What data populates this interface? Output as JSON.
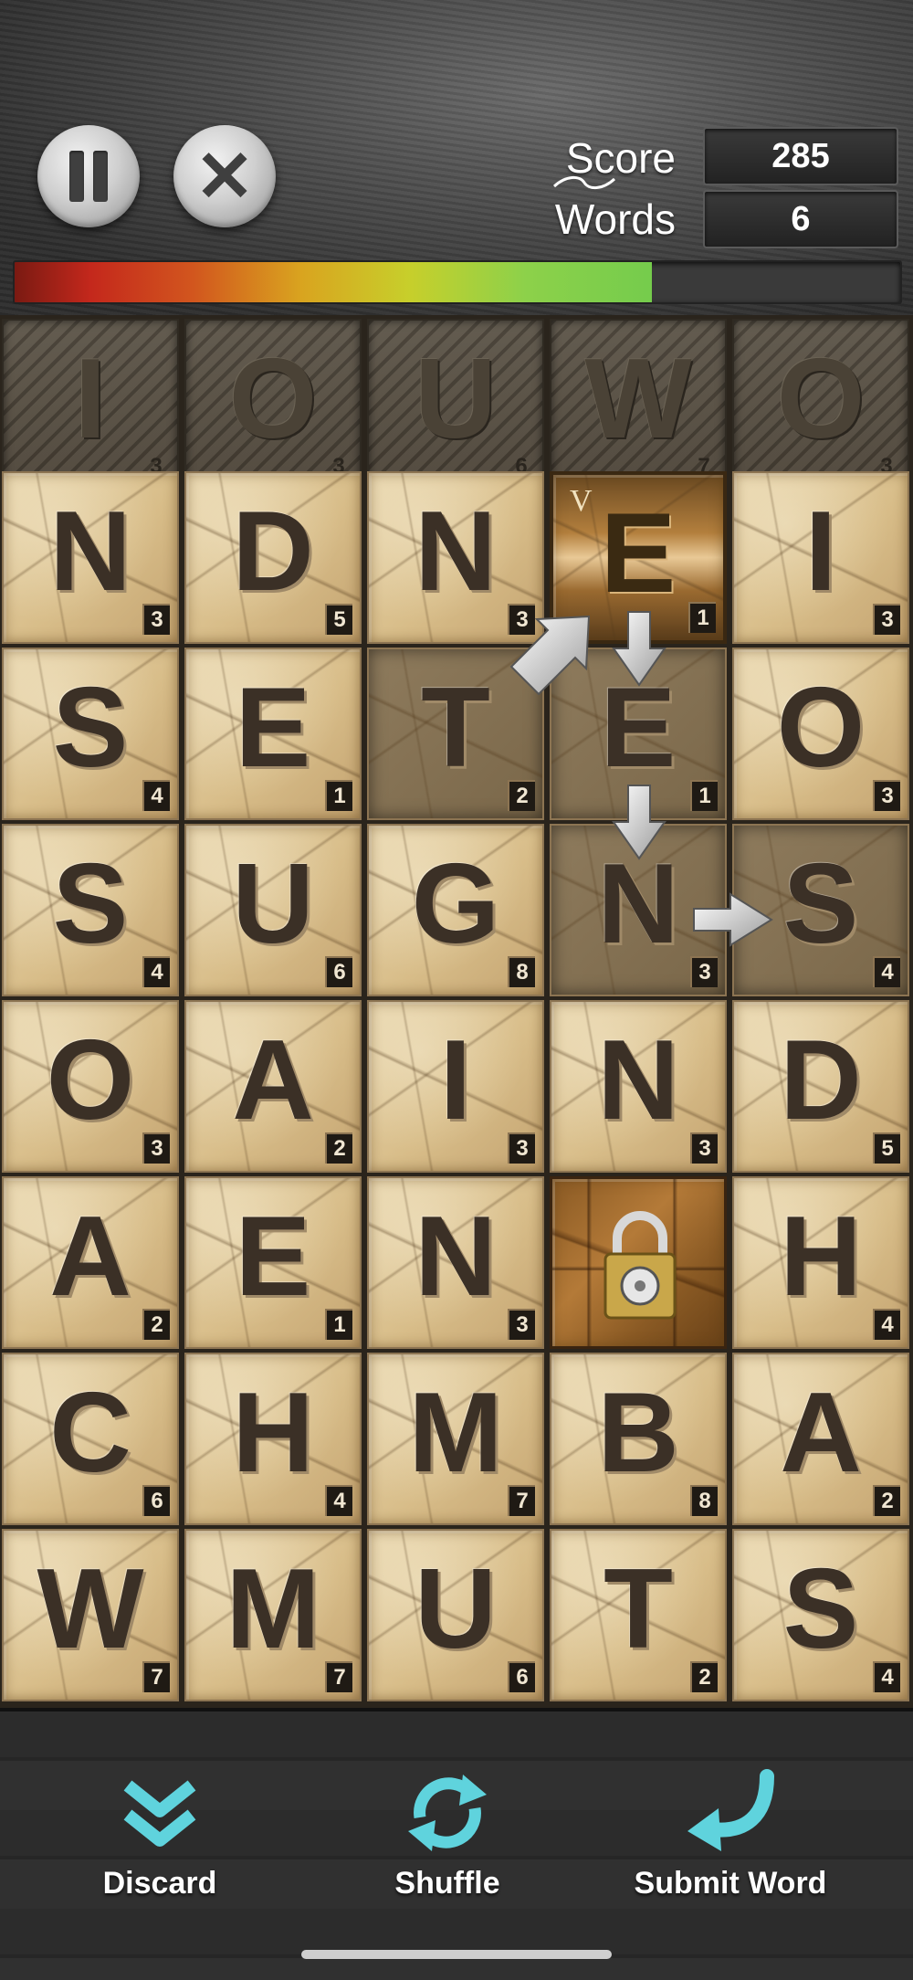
{
  "header": {
    "pause_icon": "pause-icon",
    "close_icon": "close-icon",
    "score_label": "Score",
    "score_value": "285",
    "words_label": "Words",
    "words_value": "6",
    "progress_fraction": 0.72
  },
  "board": {
    "top_row": [
      {
        "letter": "I",
        "points": "3"
      },
      {
        "letter": "O",
        "points": "3"
      },
      {
        "letter": "U",
        "points": "6"
      },
      {
        "letter": "W",
        "points": "7"
      },
      {
        "letter": "O",
        "points": "3"
      }
    ],
    "rows": [
      [
        {
          "letter": "N",
          "points": "3"
        },
        {
          "letter": "D",
          "points": "5"
        },
        {
          "letter": "N",
          "points": "3"
        },
        {
          "letter": "E",
          "points": "1",
          "state": "selected",
          "bonus": "V"
        },
        {
          "letter": "I",
          "points": "3"
        }
      ],
      [
        {
          "letter": "S",
          "points": "4"
        },
        {
          "letter": "E",
          "points": "1"
        },
        {
          "letter": "T",
          "points": "2",
          "state": "dim"
        },
        {
          "letter": "E",
          "points": "1",
          "state": "dim"
        },
        {
          "letter": "O",
          "points": "3"
        }
      ],
      [
        {
          "letter": "S",
          "points": "4"
        },
        {
          "letter": "U",
          "points": "6"
        },
        {
          "letter": "G",
          "points": "8"
        },
        {
          "letter": "N",
          "points": "3",
          "state": "dim"
        },
        {
          "letter": "S",
          "points": "4",
          "state": "dim"
        }
      ],
      [
        {
          "letter": "O",
          "points": "3"
        },
        {
          "letter": "A",
          "points": "2"
        },
        {
          "letter": "I",
          "points": "3"
        },
        {
          "letter": "N",
          "points": "3"
        },
        {
          "letter": "D",
          "points": "5"
        }
      ],
      [
        {
          "letter": "A",
          "points": "2"
        },
        {
          "letter": "E",
          "points": "1"
        },
        {
          "letter": "N",
          "points": "3"
        },
        {
          "letter": "",
          "points": "",
          "state": "locked"
        },
        {
          "letter": "H",
          "points": "4"
        }
      ],
      [
        {
          "letter": "C",
          "points": "6"
        },
        {
          "letter": "H",
          "points": "4"
        },
        {
          "letter": "M",
          "points": "7"
        },
        {
          "letter": "B",
          "points": "8"
        },
        {
          "letter": "A",
          "points": "2"
        }
      ],
      [
        {
          "letter": "W",
          "points": "7"
        },
        {
          "letter": "M",
          "points": "7"
        },
        {
          "letter": "U",
          "points": "6"
        },
        {
          "letter": "T",
          "points": "2"
        },
        {
          "letter": "S",
          "points": "4"
        }
      ]
    ]
  },
  "toolbar": {
    "discard_label": "Discard",
    "shuffle_label": "Shuffle",
    "submit_label": "Submit Word",
    "icon_color": "#5fd3dd"
  }
}
